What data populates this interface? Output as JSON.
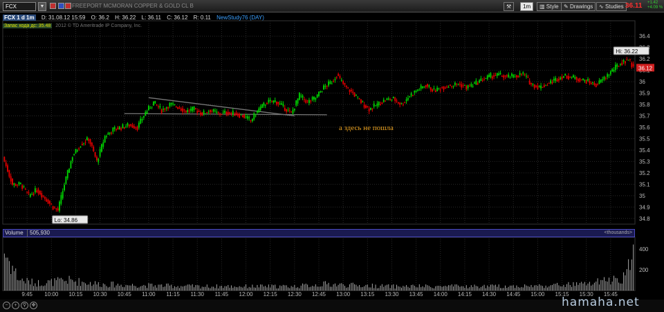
{
  "toolbar": {
    "symbol": "FCX",
    "company": "FREEPORT MCMORAN COPPER & GOLD CL B",
    "interval": "1m",
    "style_label": "Style",
    "drawings_label": "Drawings",
    "studies_label": "Studies",
    "last_price": "36.11",
    "change_top": "+1.42",
    "change_bottom": "+4.09 %"
  },
  "infobar": {
    "symbol_period": "FCX 1 d 1m",
    "date": "D: 31.08.12 15:59",
    "open": "O: 36.2",
    "high": "H: 36.22",
    "low": "L: 36.11",
    "close": "C: 36.12",
    "range": "R: 0.11",
    "study": "NewStudy76 (DAY)"
  },
  "studybar": {
    "label": "Запас хода дс: 35.48",
    "copyright": "2012 © TD Ameritrade IP Company, Inc."
  },
  "annotation": "а здесь не пошла",
  "volume": {
    "label": "Volume",
    "value": "505,930",
    "units": "<thousands>"
  },
  "watermark": "hamaha.net",
  "colors": {
    "up": "#00d000",
    "down": "#e00000",
    "grid": "#2a2a2a",
    "volume": "#a8a8a8",
    "annotation": "#e8a020"
  },
  "chart_data": {
    "type": "candlestick",
    "y_ticks": [
      34.8,
      34.9,
      35,
      35.1,
      35.2,
      35.3,
      35.4,
      35.5,
      35.6,
      35.7,
      35.8,
      35.9,
      36,
      36.1,
      36.2,
      36.3,
      36.4
    ],
    "ylim": [
      34.75,
      36.45
    ],
    "x_ticks": [
      "9:45",
      "10:00",
      "10:15",
      "10:30",
      "10:45",
      "11:00",
      "11:15",
      "11:30",
      "11:45",
      "12:00",
      "12:15",
      "12:30",
      "12:45",
      "13:00",
      "13:15",
      "13:30",
      "13:45",
      "14:00",
      "14:15",
      "14:30",
      "14:45",
      "15:00",
      "15:15",
      "15:30",
      "15:45"
    ],
    "hi_label": "Hi: 36.22",
    "lo_label": "Lo: 34.86",
    "last_price_label": "36.12",
    "volume_ticks": [
      "400",
      "200"
    ],
    "trendlines": [
      {
        "from": [
          "11:00",
          35.86
        ],
        "to": [
          "12:30",
          35.7
        ]
      },
      {
        "from": [
          "10:45",
          35.72
        ],
        "to": [
          "12:50",
          35.71
        ]
      }
    ],
    "price_path": [
      [
        "9:31",
        35.3
      ],
      [
        "9:36",
        35.1
      ],
      [
        "9:41",
        35.1
      ],
      [
        "9:46",
        35.0
      ],
      [
        "9:51",
        35.05
      ],
      [
        "9:56",
        34.98
      ],
      [
        "10:01",
        34.9
      ],
      [
        "10:04",
        34.87
      ],
      [
        "10:08",
        35.1
      ],
      [
        "10:13",
        35.35
      ],
      [
        "10:18",
        35.45
      ],
      [
        "10:23",
        35.5
      ],
      [
        "10:28",
        35.3
      ],
      [
        "10:33",
        35.52
      ],
      [
        "10:38",
        35.58
      ],
      [
        "10:43",
        35.6
      ],
      [
        "10:48",
        35.62
      ],
      [
        "10:53",
        35.6
      ],
      [
        "10:58",
        35.73
      ],
      [
        "11:03",
        35.82
      ],
      [
        "11:08",
        35.75
      ],
      [
        "11:13",
        35.8
      ],
      [
        "11:18",
        35.78
      ],
      [
        "11:23",
        35.74
      ],
      [
        "11:28",
        35.76
      ],
      [
        "11:33",
        35.72
      ],
      [
        "11:38",
        35.75
      ],
      [
        "11:43",
        35.72
      ],
      [
        "11:48",
        35.73
      ],
      [
        "11:53",
        35.72
      ],
      [
        "11:58",
        35.7
      ],
      [
        "12:03",
        35.66
      ],
      [
        "12:08",
        35.76
      ],
      [
        "12:13",
        35.82
      ],
      [
        "12:18",
        35.83
      ],
      [
        "12:23",
        35.78
      ],
      [
        "12:28",
        35.72
      ],
      [
        "12:33",
        35.88
      ],
      [
        "12:38",
        35.82
      ],
      [
        "12:43",
        35.86
      ],
      [
        "12:48",
        35.95
      ],
      [
        "12:53",
        36.0
      ],
      [
        "12:56",
        36.06
      ],
      [
        "13:01",
        35.96
      ],
      [
        "13:06",
        35.9
      ],
      [
        "13:11",
        35.82
      ],
      [
        "13:16",
        35.76
      ],
      [
        "13:21",
        35.8
      ],
      [
        "13:26",
        35.84
      ],
      [
        "13:31",
        35.85
      ],
      [
        "13:36",
        35.8
      ],
      [
        "13:41",
        35.88
      ],
      [
        "13:46",
        35.93
      ],
      [
        "13:51",
        35.97
      ],
      [
        "13:56",
        35.92
      ],
      [
        "14:01",
        35.95
      ],
      [
        "14:06",
        35.97
      ],
      [
        "14:11",
        35.98
      ],
      [
        "14:16",
        35.95
      ],
      [
        "14:21",
        35.98
      ],
      [
        "14:26",
        36.02
      ],
      [
        "14:31",
        36.05
      ],
      [
        "14:36",
        36.06
      ],
      [
        "14:41",
        36.04
      ],
      [
        "14:46",
        36.05
      ],
      [
        "14:51",
        36.07
      ],
      [
        "14:56",
        35.98
      ],
      [
        "15:01",
        35.95
      ],
      [
        "15:06",
        35.98
      ],
      [
        "15:11",
        36.02
      ],
      [
        "15:16",
        36.05
      ],
      [
        "15:21",
        36.04
      ],
      [
        "15:26",
        36.02
      ],
      [
        "15:31",
        36.0
      ],
      [
        "15:36",
        35.97
      ],
      [
        "15:41",
        36.03
      ],
      [
        "15:46",
        36.1
      ],
      [
        "15:51",
        36.16
      ],
      [
        "15:56",
        36.2
      ],
      [
        "15:59",
        36.12
      ]
    ],
    "volume_profile": [
      [
        "9:31",
        420
      ],
      [
        "9:40",
        120
      ],
      [
        "9:50",
        80
      ],
      [
        "10:00",
        90
      ],
      [
        "10:10",
        110
      ],
      [
        "10:20",
        90
      ],
      [
        "10:30",
        70
      ],
      [
        "10:45",
        60
      ],
      [
        "11:00",
        55
      ],
      [
        "11:30",
        45
      ],
      [
        "12:00",
        45
      ],
      [
        "12:30",
        45
      ],
      [
        "12:50",
        70
      ],
      [
        "13:00",
        60
      ],
      [
        "13:30",
        45
      ],
      [
        "14:00",
        45
      ],
      [
        "14:30",
        45
      ],
      [
        "15:00",
        50
      ],
      [
        "15:30",
        70
      ],
      [
        "15:45",
        110
      ],
      [
        "15:55",
        160
      ],
      [
        "15:59",
        470
      ]
    ]
  }
}
